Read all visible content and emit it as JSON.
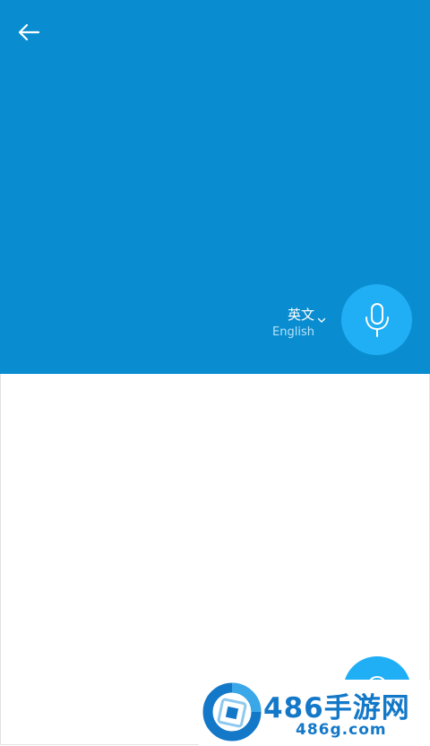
{
  "colors": {
    "primary": "#0a8dd0",
    "accent": "#20aef5",
    "secondary_text": "#b7e1f6",
    "watermark": "#1478c8"
  },
  "header": {
    "back_icon": "arrow-left-icon"
  },
  "language": {
    "primary": "英文",
    "secondary": "English",
    "dropdown_icon": "chevron-down-icon"
  },
  "mic_button": {
    "icon": "microphone-icon"
  },
  "watermark": {
    "title": "486手游网",
    "domain": "486g.com"
  }
}
